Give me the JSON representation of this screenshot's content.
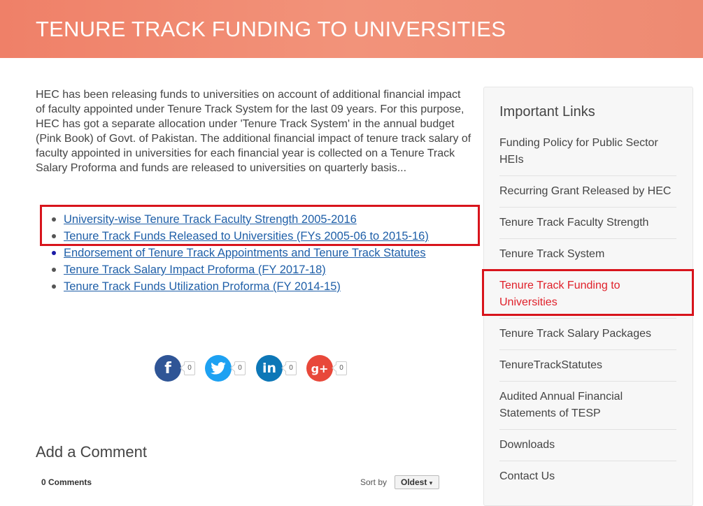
{
  "banner": {
    "title": "TENURE TRACK FUNDING TO UNIVERSITIES"
  },
  "intro": "HEC has been releasing funds to universities on account of additional financial impact of faculty appointed under Tenure Track System for the last 09 years. For this purpose, HEC has got a separate allocation under 'Tenure Track System' in the annual budget (Pink Book) of Govt. of Pakistan. The additional financial impact of tenure track salary of faculty appointed in universities for each financial year is collected on a Tenure Track Salary Proforma and funds are released to universities on quarterly basis...",
  "links": [
    {
      "label": "University-wise Tenure Track Faculty Strength 2005-2016"
    },
    {
      "label": "Tenure Track Funds Released to Universities (FYs 2005-06 to 2015-16)"
    },
    {
      "label": "Endorsement of Tenure Track Appointments and Tenure Track Statutes"
    },
    {
      "label": "Tenure Track Salary Impact Proforma (FY 2017-18)"
    },
    {
      "label": "Tenure Track Funds Utilization Proforma (FY 2014-15)"
    }
  ],
  "share": {
    "facebook": {
      "icon": "f",
      "count": "0",
      "color": "#2f5596"
    },
    "twitter": {
      "icon": "twitter-bird",
      "count": "0",
      "color": "#1da1f2"
    },
    "linkedin": {
      "icon": "in",
      "count": "0",
      "color": "#0d77b7"
    },
    "googleplus": {
      "icon": "g+",
      "count": "0",
      "color": "#e8483a"
    }
  },
  "comments": {
    "title": "Add a Comment",
    "count_label": "0 Comments",
    "sort_label": "Sort by",
    "sort_value": "Oldest"
  },
  "sidebar": {
    "title": "Important Links",
    "items": [
      {
        "label": "Funding Policy for Public Sector HEIs"
      },
      {
        "label": "Recurring Grant Released by HEC"
      },
      {
        "label": "Tenure Track Faculty Strength"
      },
      {
        "label": "Tenure Track System"
      },
      {
        "label": "Tenure Track Funding to Universities",
        "active": true
      },
      {
        "label": "Tenure Track Salary Packages"
      },
      {
        "label": "TenureTrackStatutes"
      },
      {
        "label": "Audited Annual Financial Statements of TESP"
      },
      {
        "label": "Downloads"
      },
      {
        "label": "Contact Us"
      }
    ]
  },
  "colors": {
    "accent": "#d8141c",
    "banner": "#ef8068",
    "link": "#1f5fa8"
  }
}
